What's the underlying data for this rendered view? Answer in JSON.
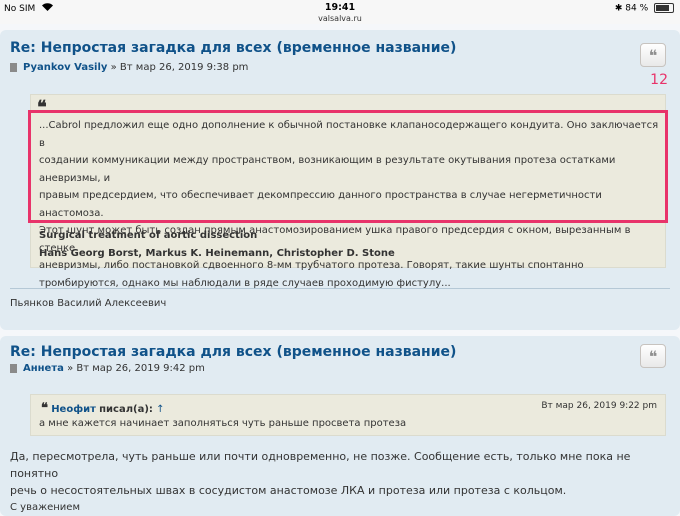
{
  "status_bar": {
    "carrier": "No SIM",
    "time": "19:41",
    "url": "valsalva.ru",
    "battery": "84 %",
    "battery_level": 0.84
  },
  "post1": {
    "title": "Re: Непростая загадка для всех (временное название)",
    "author": "Pyankov Vasily",
    "date": "» Вт мар 26, 2019 9:38 pm",
    "post_number": "12",
    "quote_lines": [
      "...Cabrol предложил еще одно дополнение к обычной постановке клапаносодержащего кондуита. Оно заключается в",
      "создании коммуникации между пространством, возникающим в результате окутывания протеза остатками аневризмы, и",
      "правым предсердием, что обеспечивает декомпрессию данного пространства в случае негерметичности анастомоза.",
      "Этот шунт может быть создан прямым анастомозированием ушка правого предсердия с окном, вырезанным в стенке",
      "аневризмы, либо постановкой сдвоенного 8-мм трубчатого протеза. Говорят, такие шунты спонтанно",
      "тромбируются, однако мы наблюдали в ряде случаев проходимую фистулу..."
    ],
    "cite_title": "Surgical treatment of aortic dissection",
    "cite_authors": "Hans Georg Borst, Markus K. Heinemann, Christopher D. Stone",
    "signature": "Пьянков Василий Алексеевич"
  },
  "post2": {
    "title": "Re: Непростая загадка для всех (временное название)",
    "author": "Аннета",
    "date": "» Вт мар 26, 2019 9:42 pm",
    "quote_author": "Неофит",
    "quote_wrote": "писал(а):",
    "quote_arrow": "↑",
    "quote_date": "Вт мар 26, 2019 9:22 pm",
    "quote_text": "а мне кажется начинает заполняться чуть раньше просвета протеза",
    "body_line1": "Да, пересмотрела, чуть раньше или почти одновременно, не позже. Сообщение есть, только мне пока не понятно",
    "body_line2": "речь о несостоятельных швах в сосудистом анастомозе ЛКА и протеза или протеза с кольцом.",
    "signature_start": "С уважением"
  },
  "icons": {
    "quote": "quote-icon",
    "post": "post-file-icon",
    "wifi": "wifi-icon",
    "bluetooth": "bluetooth-icon",
    "battery": "battery-icon"
  },
  "colors": {
    "post_bg": "#e1ebf2",
    "title": "#105289",
    "highlight": "#e8336a",
    "quote_bg": "#ebeadd"
  }
}
